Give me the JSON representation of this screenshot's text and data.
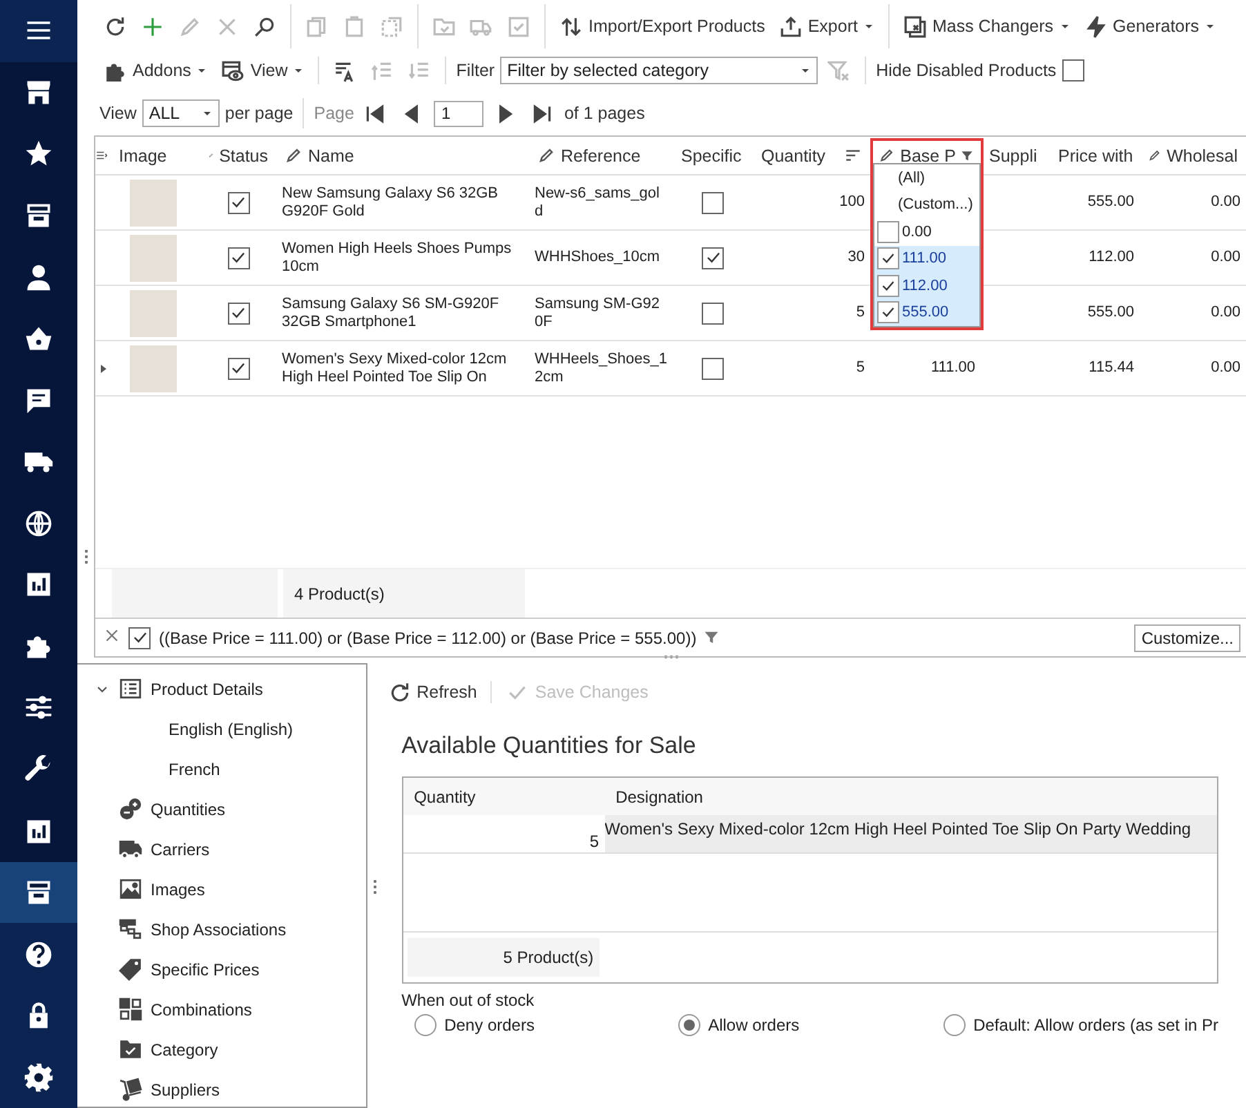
{
  "sidebar": {
    "sections": [
      {
        "items": [
          {
            "selected": false
          }
        ]
      },
      {
        "items": [
          {
            "selected": false
          },
          {
            "selected": false
          },
          {
            "selected": false
          },
          {
            "selected": false
          },
          {
            "selected": false
          },
          {
            "selected": false
          },
          {
            "selected": false
          },
          {
            "selected": false
          },
          {
            "selected": false
          },
          {
            "selected": false
          },
          {
            "selected": false
          },
          {
            "selected": false
          },
          {
            "selected": false
          }
        ]
      },
      {
        "items": [
          {
            "selected": true
          },
          {
            "selected": false
          },
          {
            "selected": false
          },
          {
            "selected": false
          }
        ]
      }
    ]
  },
  "toolbar_rows": [
    {
      "groups": [
        {
          "items": [
            {
              "kind": "button",
              "disabled": false
            },
            {
              "kind": "button",
              "disabled": false
            },
            {
              "kind": "button",
              "disabled": true
            },
            {
              "kind": "button",
              "disabled": true
            },
            {
              "kind": "button",
              "disabled": false
            }
          ]
        },
        {
          "items": [
            {
              "kind": "button",
              "disabled": true
            },
            {
              "kind": "button",
              "disabled": true
            },
            {
              "kind": "button",
              "disabled": true
            }
          ]
        },
        {
          "items": [
            {
              "kind": "button",
              "disabled": true
            },
            {
              "kind": "button",
              "disabled": true
            },
            {
              "kind": "button",
              "disabled": true
            }
          ]
        },
        {
          "items": [
            {
              "kind": "button",
              "label": "Import/Export Products",
              "disabled": false
            },
            {
              "kind": "button",
              "label": "Export",
              "disabled": false,
              "dropdown": true
            }
          ]
        },
        {
          "items": [
            {
              "kind": "button",
              "label": "Mass Changers",
              "disabled": false,
              "dropdown": true
            },
            {
              "kind": "button",
              "label": "Generators",
              "disabled": false,
              "dropdown": true
            }
          ]
        }
      ]
    },
    {
      "groups": [
        {
          "items": [
            {
              "kind": "button",
              "label": "Addons",
              "disabled": false,
              "dropdown": true
            },
            {
              "kind": "button",
              "label": "View",
              "disabled": false,
              "dropdown": true
            }
          ]
        },
        {
          "items": [
            {
              "kind": "button",
              "disabled": false
            },
            {
              "kind": "button",
              "disabled": true
            },
            {
              "kind": "button",
              "disabled": true
            }
          ]
        },
        {
          "items": [
            {
              "kind": "label",
              "label": "Filter",
              "disabled": false
            },
            {
              "kind": "select",
              "value": "Filter by selected category",
              "wide": true
            },
            {
              "kind": "button",
              "disabled": true
            }
          ]
        },
        {
          "items": [
            {
              "kind": "checkbox",
              "label": "Hide Disabled Products",
              "checked": false
            }
          ]
        }
      ]
    },
    {
      "groups": [
        {
          "items": [
            {
              "kind": "label",
              "label": "View",
              "disabled": false
            },
            {
              "kind": "select",
              "value": "ALL",
              "wide": false
            },
            {
              "kind": "label",
              "label": "per page",
              "disabled": false
            }
          ]
        },
        {
          "items": [
            {
              "kind": "label",
              "label": "Page",
              "disabled": true
            },
            {
              "kind": "button",
              "disabled": false
            },
            {
              "kind": "button",
              "disabled": false
            },
            {
              "kind": "input",
              "value": "1"
            },
            {
              "kind": "button",
              "disabled": false
            },
            {
              "kind": "button",
              "disabled": false
            },
            {
              "kind": "label",
              "label": "of 1 pages",
              "disabled": false
            }
          ]
        }
      ]
    }
  ],
  "grid": {
    "columns": [
      {
        "label": "Image",
        "editable": false
      },
      {
        "label": "Status",
        "editable": true
      },
      {
        "label": "Name",
        "editable": true
      },
      {
        "label": "Reference",
        "editable": true
      },
      {
        "label": "Specific",
        "editable": false
      },
      {
        "label": "Quantity",
        "editable": false,
        "sorted": true
      },
      {
        "label": "Base P",
        "editable": true,
        "filtered": true
      },
      {
        "label": "Suppli",
        "editable": false
      },
      {
        "label": "Price with",
        "editable": false
      },
      {
        "label": "Wholesal",
        "editable": true
      }
    ],
    "rows": [
      {
        "current": false,
        "status": true,
        "name": "New Samsung Galaxy S6 32GB G920F Gold",
        "reference": "New-s6_sams_gold",
        "specific": false,
        "quantity": "100",
        "price_with": "555.00",
        "wholesale": "0.00"
      },
      {
        "current": false,
        "status": true,
        "name": "Women High Heels Shoes Pumps 10cm",
        "reference": "WHHShoes_10cm",
        "specific": true,
        "quantity": "30",
        "price_with": "112.00",
        "wholesale": "0.00"
      },
      {
        "current": false,
        "status": true,
        "name": "Samsung Galaxy S6 SM-G920F 32GB Smartphone1",
        "reference": "Samsung SM-G920F",
        "specific": false,
        "quantity": "5",
        "price_with": "555.00",
        "wholesale": "0.00"
      },
      {
        "current": true,
        "status": true,
        "name": "Women's Sexy Mixed-color 12cm High Heel Pointed Toe Slip On",
        "reference": "WHHeels_Shoes_12cm",
        "specific": false,
        "quantity": "5",
        "base_price": "111.00",
        "price_with": "115.44",
        "wholesale": "0.00"
      }
    ],
    "summary": "4 Product(s)"
  },
  "filter_popup": {
    "items": [
      {
        "kind": "option",
        "label": "(All)"
      },
      {
        "kind": "option",
        "label": "(Custom...)"
      },
      {
        "kind": "check",
        "label": "0.00",
        "checked": false
      },
      {
        "kind": "check",
        "label": "111.00",
        "checked": true
      },
      {
        "kind": "check",
        "label": "112.00",
        "checked": true
      },
      {
        "kind": "check",
        "label": "555.00",
        "checked": true
      }
    ]
  },
  "filter_bar": {
    "enabled": true,
    "expression": "((Base Price = 111.00) or (Base Price = 112.00) or (Base Price = 555.00))",
    "customize": "Customize..."
  },
  "tree": {
    "items": [
      {
        "label": "Product Details",
        "expanded": true,
        "selected": false,
        "children": [
          {
            "label": "English (English)",
            "selected": false
          },
          {
            "label": "French",
            "selected": false
          }
        ]
      },
      {
        "label": "Quantities",
        "selected": false
      },
      {
        "label": "Carriers",
        "selected": false
      },
      {
        "label": "Images",
        "selected": false
      },
      {
        "label": "Shop Associations",
        "selected": false
      },
      {
        "label": "Specific Prices",
        "selected": false
      },
      {
        "label": "Combinations",
        "selected": false
      },
      {
        "label": "Category",
        "selected": false
      },
      {
        "label": "Suppliers",
        "selected": false
      }
    ]
  },
  "detail": {
    "toolbar": [
      {
        "label": "Refresh",
        "disabled": false
      },
      {
        "label": "Save Changes",
        "disabled": true
      }
    ],
    "title": "Available Quantities for Sale",
    "table": {
      "columns": [
        "Quantity",
        "Designation"
      ],
      "rows": [
        {
          "quantity": "5",
          "designation": "Women's Sexy Mixed-color 12cm High Heel Pointed Toe Slip On Party Wedding"
        }
      ],
      "summary": "5 Product(s)"
    },
    "stock_label": "When out of stock",
    "options": [
      {
        "label": "Deny orders",
        "selected": false
      },
      {
        "label": "Allow orders",
        "selected": true
      },
      {
        "label": "Default: Allow orders (as set in Pr",
        "selected": false
      }
    ]
  }
}
